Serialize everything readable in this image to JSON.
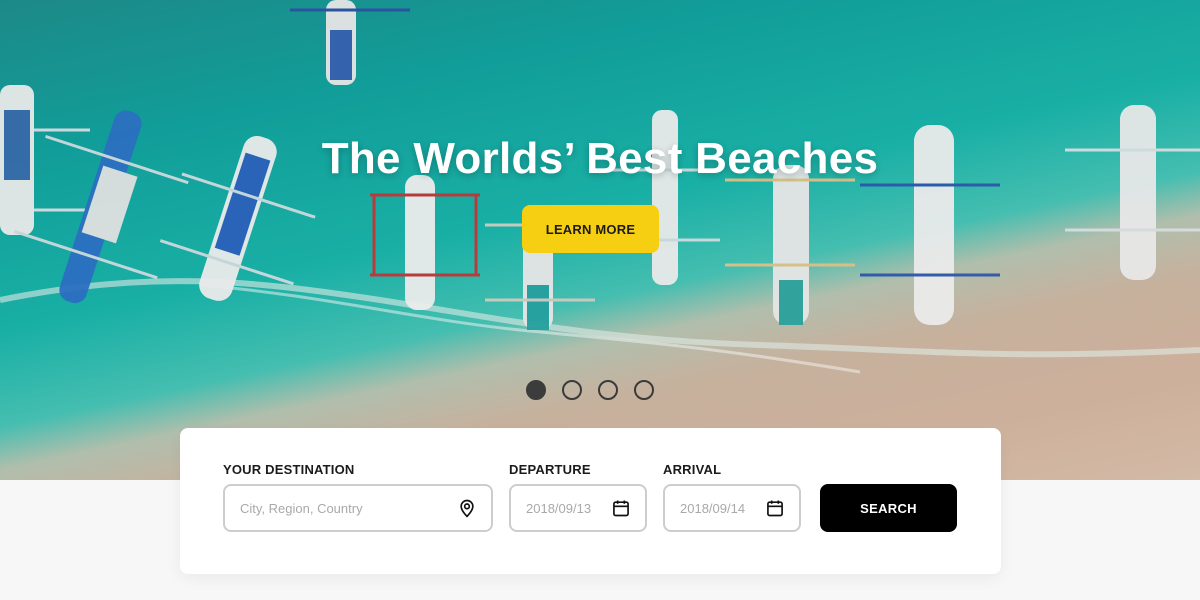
{
  "hero": {
    "title": "The Worlds’ Best Beaches",
    "cta_label": "LEARN MORE",
    "slides": [
      {
        "active": true
      },
      {
        "active": false
      },
      {
        "active": false
      },
      {
        "active": false
      }
    ]
  },
  "search": {
    "destination": {
      "label": "YOUR DESTINATION",
      "placeholder": "City, Region, Country",
      "icon": "map-pin-icon"
    },
    "departure": {
      "label": "DEPARTURE",
      "value": "2018/09/13",
      "icon": "calendar-icon"
    },
    "arrival": {
      "label": "ARRIVAL",
      "value": "2018/09/14",
      "icon": "calendar-icon"
    },
    "button_label": "SEARCH"
  },
  "colors": {
    "accent_yellow": "#f7cf12",
    "button_black": "#000000",
    "field_border": "#cdcdcd",
    "page_bg": "#f7f7f7"
  }
}
